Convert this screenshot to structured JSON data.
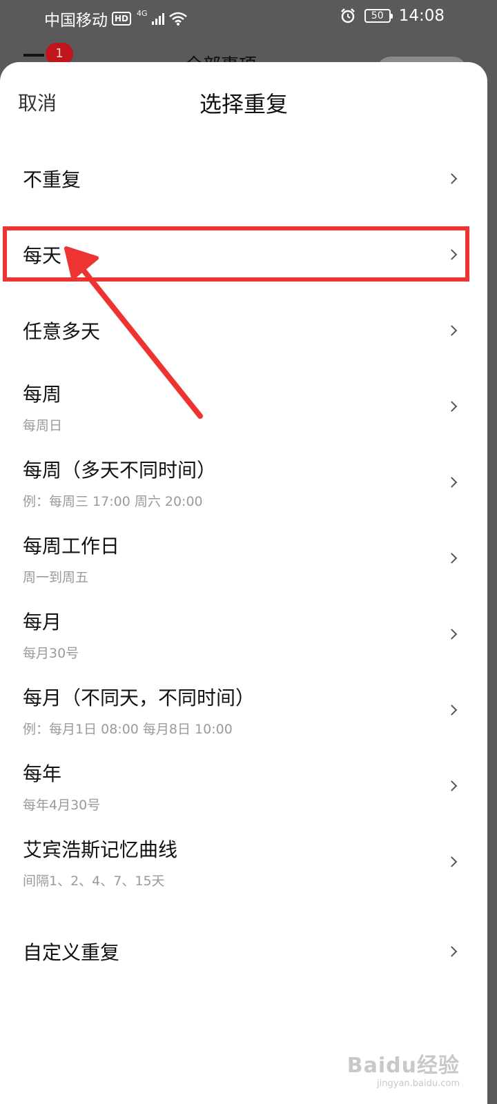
{
  "status_bar": {
    "carrier": "中国移动",
    "hd_badge": "HD",
    "network": "4G",
    "battery_level": "50",
    "time": "14:08"
  },
  "background_page": {
    "badge_count": "1",
    "title": "全部事项"
  },
  "sheet": {
    "cancel_label": "取消",
    "title": "选择重复",
    "options": [
      {
        "label": "不重复",
        "sub": ""
      },
      {
        "label": "每天",
        "sub": ""
      },
      {
        "label": "任意多天",
        "sub": ""
      },
      {
        "label": "每周",
        "sub": "每周日"
      },
      {
        "label": "每周（多天不同时间）",
        "sub": "例：每周三 17:00  周六 20:00"
      },
      {
        "label": "每周工作日",
        "sub": "周一到周五"
      },
      {
        "label": "每月",
        "sub": "每月30号"
      },
      {
        "label": "每月（不同天，不同时间）",
        "sub": "例：每月1日 08:00  每月8日 10:00"
      },
      {
        "label": "每年",
        "sub": "每年4月30号"
      },
      {
        "label": "艾宾浩斯记忆曲线",
        "sub": "间隔1、2、4、7、15天"
      },
      {
        "label": "自定义重复",
        "sub": ""
      }
    ]
  },
  "annotation": {
    "highlighted_option": "每天",
    "color": "#ee3333"
  },
  "watermark": {
    "main": "Baidu经验",
    "sub": "jingyan.baidu.com"
  }
}
